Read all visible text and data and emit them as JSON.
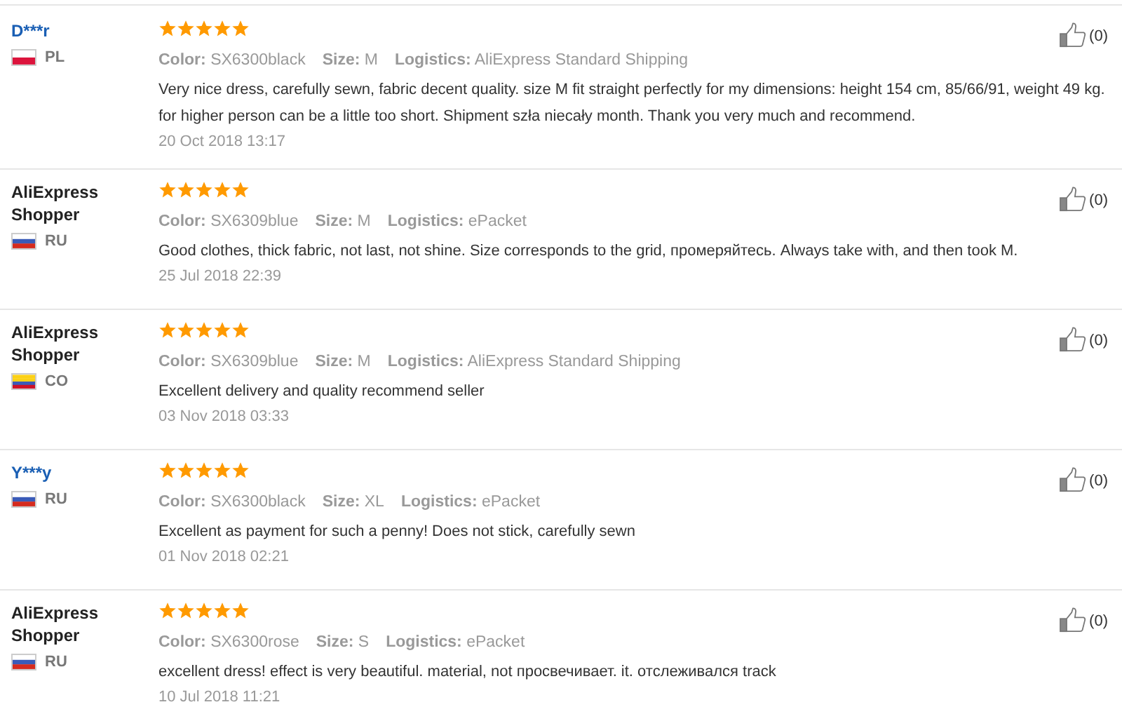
{
  "reviews": [
    {
      "name": "D***r",
      "kind": "masked",
      "country": "PL",
      "flag": {
        "kind": "poland"
      },
      "stars": 5,
      "color_label": "Color:",
      "color_value": "SX6300black",
      "size_label": "Size:",
      "size_value": "M",
      "logistics_label": "Logistics:",
      "logistics_value": "AliExpress Standard Shipping",
      "text": "Very nice dress, carefully sewn, fabric decent quality. size M fit straight perfectly for my dimensions: height 154 cm, 85/66/91, weight 49 kg. for higher person can be a little too short. Shipment szła niecały month. Thank you very much and recommend.",
      "date": "20 Oct 2018 13:17",
      "likes": "(0)"
    },
    {
      "name": "AliExpress Shopper",
      "kind": "anonymous",
      "country": "RU",
      "flag": {
        "kind": "russia"
      },
      "stars": 5,
      "color_label": "Color:",
      "color_value": "SX6309blue",
      "size_label": "Size:",
      "size_value": "M",
      "logistics_label": "Logistics:",
      "logistics_value": "ePacket",
      "text": "Good clothes, thick fabric, not last, not shine. Size corresponds to the grid, промеряйтесь. Always take with, and then took M.",
      "date": "25 Jul 2018 22:39",
      "likes": "(0)"
    },
    {
      "name": "AliExpress Shopper",
      "kind": "anonymous",
      "country": "CO",
      "flag": {
        "kind": "colombia"
      },
      "stars": 5,
      "color_label": "Color:",
      "color_value": "SX6309blue",
      "size_label": "Size:",
      "size_value": "M",
      "logistics_label": "Logistics:",
      "logistics_value": "AliExpress Standard Shipping",
      "text": "Excellent delivery and quality recommend seller",
      "date": "03 Nov 2018 03:33",
      "likes": "(0)"
    },
    {
      "name": "Y***y",
      "kind": "masked",
      "country": "RU",
      "flag": {
        "kind": "russia"
      },
      "stars": 5,
      "color_label": "Color:",
      "color_value": "SX6300black",
      "size_label": "Size:",
      "size_value": "XL",
      "logistics_label": "Logistics:",
      "logistics_value": "ePacket",
      "text": "Excellent as payment for such a penny! Does not stick, carefully sewn",
      "date": "01 Nov 2018 02:21",
      "likes": "(0)"
    },
    {
      "name": "AliExpress Shopper",
      "kind": "anonymous",
      "country": "RU",
      "flag": {
        "kind": "russia"
      },
      "stars": 5,
      "color_label": "Color:",
      "color_value": "SX6300rose",
      "size_label": "Size:",
      "size_value": "S",
      "logistics_label": "Logistics:",
      "logistics_value": "ePacket",
      "text": "excellent dress! effect is very beautiful. material, not просвечивает. it. отслеживался track",
      "date": "10 Jul 2018 11:21",
      "likes": "(0)"
    }
  ]
}
